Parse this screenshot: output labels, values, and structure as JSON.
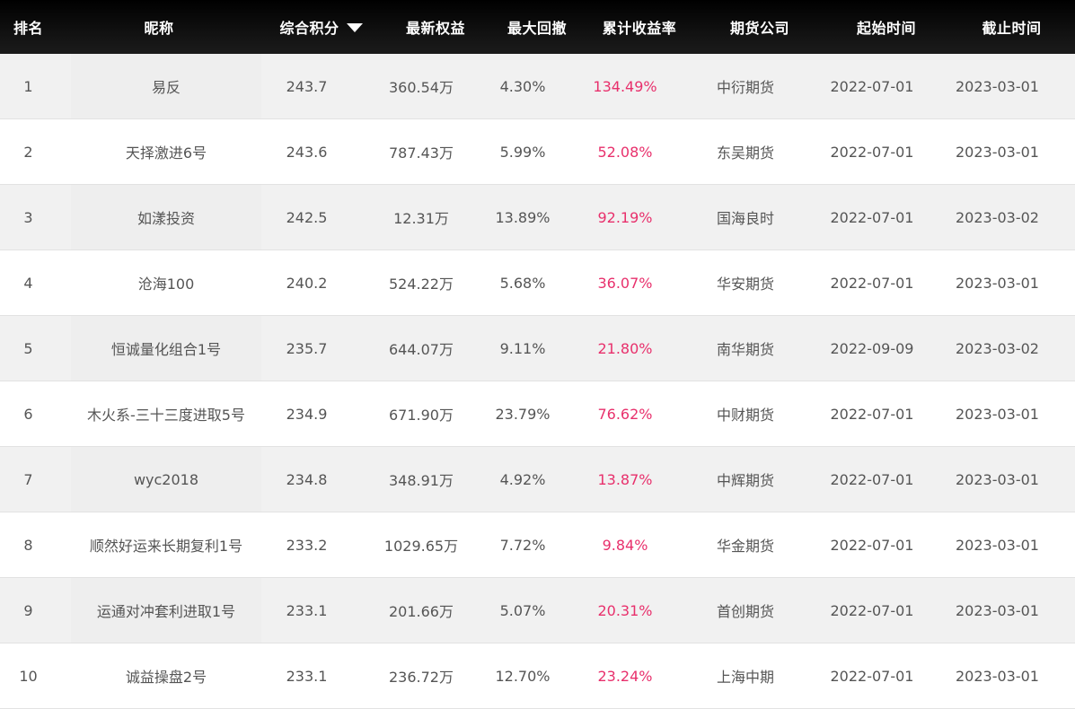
{
  "header": {
    "rank": "排名",
    "name": "昵称",
    "score": "综合积分",
    "equity": "最新权益",
    "drawdown": "最大回撤",
    "return": "累计收益率",
    "company": "期货公司",
    "start": "起始时间",
    "end": "截止时间"
  },
  "rows": [
    {
      "rank": "1",
      "name": "易反",
      "score": "243.7",
      "equity": "360.54万",
      "drawdown": "4.30%",
      "return": "134.49%",
      "company": "中衍期货",
      "start": "2022-07-01",
      "end": "2023-03-01"
    },
    {
      "rank": "2",
      "name": "天择激进6号",
      "score": "243.6",
      "equity": "787.43万",
      "drawdown": "5.99%",
      "return": "52.08%",
      "company": "东吴期货",
      "start": "2022-07-01",
      "end": "2023-03-01"
    },
    {
      "rank": "3",
      "name": "如漾投资",
      "score": "242.5",
      "equity": "12.31万",
      "drawdown": "13.89%",
      "return": "92.19%",
      "company": "国海良时",
      "start": "2022-07-01",
      "end": "2023-03-02"
    },
    {
      "rank": "4",
      "name": "沧海100",
      "score": "240.2",
      "equity": "524.22万",
      "drawdown": "5.68%",
      "return": "36.07%",
      "company": "华安期货",
      "start": "2022-07-01",
      "end": "2023-03-01"
    },
    {
      "rank": "5",
      "name": "恒诚量化组合1号",
      "score": "235.7",
      "equity": "644.07万",
      "drawdown": "9.11%",
      "return": "21.80%",
      "company": "南华期货",
      "start": "2022-09-09",
      "end": "2023-03-02"
    },
    {
      "rank": "6",
      "name": "木火系-三十三度进取5号",
      "score": "234.9",
      "equity": "671.90万",
      "drawdown": "23.79%",
      "return": "76.62%",
      "company": "中财期货",
      "start": "2022-07-01",
      "end": "2023-03-01"
    },
    {
      "rank": "7",
      "name": "wyc2018",
      "score": "234.8",
      "equity": "348.91万",
      "drawdown": "4.92%",
      "return": "13.87%",
      "company": "中辉期货",
      "start": "2022-07-01",
      "end": "2023-03-01"
    },
    {
      "rank": "8",
      "name": "顺然好运来长期复利1号",
      "score": "233.2",
      "equity": "1029.65万",
      "drawdown": "7.72%",
      "return": "9.84%",
      "company": "华金期货",
      "start": "2022-07-01",
      "end": "2023-03-01"
    },
    {
      "rank": "9",
      "name": "运通对冲套利进取1号",
      "score": "233.1",
      "equity": "201.66万",
      "drawdown": "5.07%",
      "return": "20.31%",
      "company": "首创期货",
      "start": "2022-07-01",
      "end": "2023-03-01"
    },
    {
      "rank": "10",
      "name": "诚益操盘2号",
      "score": "233.1",
      "equity": "236.72万",
      "drawdown": "12.70%",
      "return": "23.24%",
      "company": "上海中期",
      "start": "2022-07-01",
      "end": "2023-03-01"
    }
  ],
  "colors": {
    "header_bg": "#111111",
    "header_text": "#ffffff",
    "return_text": "#e8306c",
    "row_alt_bg": "#f1f1f1"
  },
  "icons": {
    "sort": "sort-desc-icon"
  }
}
